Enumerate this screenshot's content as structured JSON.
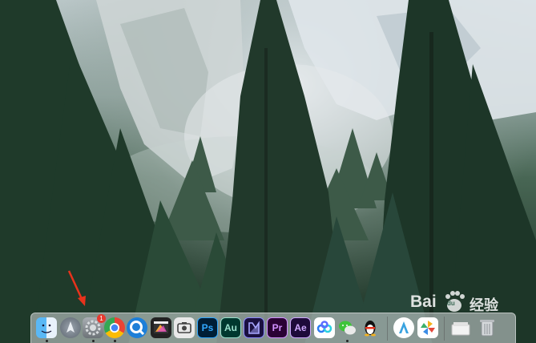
{
  "desktop": {
    "wallpaper": "forest-and-granite-cliff"
  },
  "dock": {
    "items": [
      {
        "name": "Finder",
        "icon": "finder-icon",
        "running": true
      },
      {
        "name": "Launchpad",
        "icon": "launchpad-icon",
        "running": false
      },
      {
        "name": "System Preferences",
        "icon": "system-preferences-icon",
        "running": true,
        "badge": "1"
      },
      {
        "name": "Chrome",
        "icon": "chrome-icon",
        "running": true
      },
      {
        "name": "QuickTime",
        "icon": "quicktime-icon",
        "running": false
      },
      {
        "name": "Final Cut Pro",
        "icon": "final-cut-icon",
        "running": false
      },
      {
        "name": "Screenshot",
        "icon": "screenshot-icon",
        "running": false
      },
      {
        "name": "Photoshop",
        "label": "Ps",
        "icon": "photoshop-icon",
        "running": false
      },
      {
        "name": "Audition",
        "label": "Au",
        "icon": "audition-icon",
        "running": false
      },
      {
        "name": "Media Encoder",
        "icon": "media-encoder-icon",
        "running": false
      },
      {
        "name": "Premiere Pro",
        "label": "Pr",
        "icon": "premiere-icon",
        "running": false
      },
      {
        "name": "After Effects",
        "label": "Ae",
        "icon": "after-effects-icon",
        "running": false
      },
      {
        "name": "Baidu Netdisk",
        "icon": "baidu-netdisk-icon",
        "running": false
      },
      {
        "name": "WeChat",
        "icon": "wechat-icon",
        "running": true
      },
      {
        "name": "QQ",
        "icon": "qq-penguin-icon",
        "running": false
      },
      {
        "name": "Arc",
        "icon": "arc-icon",
        "running": false
      },
      {
        "name": "Photos",
        "icon": "pinwheel-icon",
        "running": false
      },
      {
        "name": "Downloads",
        "icon": "folder-stack-icon",
        "running": false
      },
      {
        "name": "Trash",
        "icon": "trash-icon",
        "running": false
      }
    ]
  },
  "annotation": {
    "arrow": "red-arrow-pointing-to-system-preferences"
  },
  "watermark": {
    "brand_left": "Bai",
    "brand_right": "经验",
    "paw": "du"
  },
  "colors": {
    "photoshop": "#001e36",
    "ps_text": "#31a8ff",
    "audition": "#00382f",
    "au_text": "#9ae0cc",
    "premiere": "#2a0134",
    "pr_text": "#d291ff",
    "after_effects": "#1e0a3a",
    "ae_text": "#cfa8ff",
    "arrow": "#e8321c"
  }
}
